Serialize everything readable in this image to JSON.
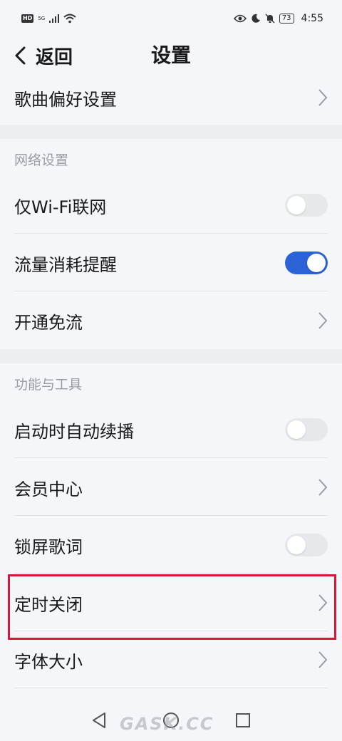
{
  "status_bar": {
    "hd": "HD",
    "signal": "5G",
    "battery": "73",
    "time": "4:55"
  },
  "header": {
    "back_label": "返回",
    "title": "设置"
  },
  "rows": {
    "song_pref": "歌曲偏好设置",
    "network_section": "网络设置",
    "wifi_only": "仅Wi-Fi联网",
    "data_reminder": "流量消耗提醒",
    "free_data": "开通免流",
    "tools_section": "功能与工具",
    "auto_resume": "启动时自动续播",
    "vip_center": "会员中心",
    "lock_lyrics": "锁屏歌词",
    "sleep_timer": "定时关闭",
    "font_size": "字体大小"
  },
  "toggles": {
    "wifi_only": "off",
    "data_reminder": "on",
    "auto_resume": "off",
    "lock_lyrics": "off"
  },
  "colors": {
    "accent": "#2b63d6",
    "highlight": "#d8173a"
  },
  "watermark": "GASK.CC"
}
